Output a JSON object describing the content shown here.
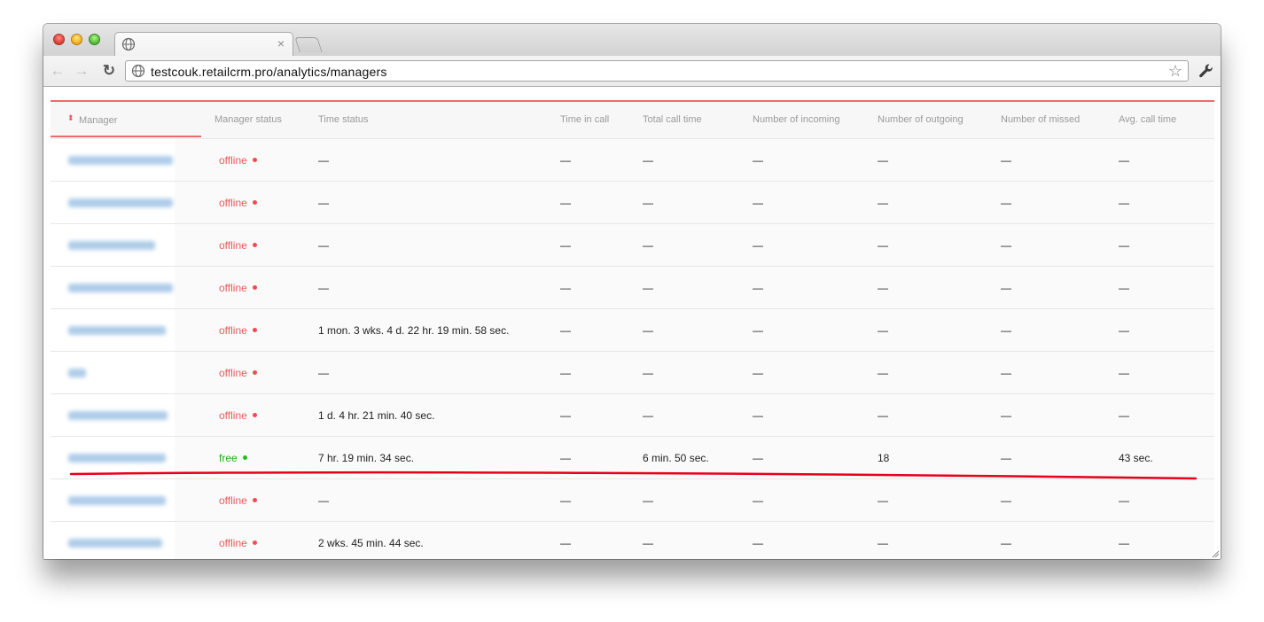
{
  "browser": {
    "url": "testcouk.retailcrm.pro/analytics/managers",
    "tab_close": "×",
    "nav_back": "←",
    "nav_forward": "→",
    "nav_reload": "↻",
    "star": "☆"
  },
  "table": {
    "headers": {
      "manager": "Manager",
      "manager_status": "Manager status",
      "time_status": "Time status",
      "time_in_call": "Time in call",
      "total_call_time": "Total call time",
      "incoming": "Number of incoming",
      "outgoing": "Number of outgoing",
      "missed": "Number of missed",
      "avg_call_time": "Avg. call time"
    },
    "sort_icon": "⬍",
    "rows": [
      {
        "status": "offline",
        "time_status": "—",
        "time_in_call": "—",
        "total": "—",
        "incoming": "—",
        "outgoing": "—",
        "missed": "—",
        "avg": "—"
      },
      {
        "status": "offline",
        "time_status": "—",
        "time_in_call": "—",
        "total": "—",
        "incoming": "—",
        "outgoing": "—",
        "missed": "—",
        "avg": "—"
      },
      {
        "status": "offline",
        "time_status": "—",
        "time_in_call": "—",
        "total": "—",
        "incoming": "—",
        "outgoing": "—",
        "missed": "—",
        "avg": "—"
      },
      {
        "status": "offline",
        "time_status": "—",
        "time_in_call": "—",
        "total": "—",
        "incoming": "—",
        "outgoing": "—",
        "missed": "—",
        "avg": "—"
      },
      {
        "status": "offline",
        "time_status": "1 mon. 3 wks. 4 d. 22 hr. 19 min. 58 sec.",
        "time_in_call": "—",
        "total": "—",
        "incoming": "—",
        "outgoing": "—",
        "missed": "—",
        "avg": "—"
      },
      {
        "status": "offline",
        "time_status": "—",
        "time_in_call": "—",
        "total": "—",
        "incoming": "—",
        "outgoing": "—",
        "missed": "—",
        "avg": "—"
      },
      {
        "status": "offline",
        "time_status": "1 d. 4 hr. 21 min. 40 sec.",
        "time_in_call": "—",
        "total": "—",
        "incoming": "—",
        "outgoing": "—",
        "missed": "—",
        "avg": "—"
      },
      {
        "status": "free",
        "time_status": "7 hr. 19 min. 34 sec.",
        "time_in_call": "—",
        "total": "6 min. 50 sec.",
        "incoming": "—",
        "outgoing": "18",
        "missed": "—",
        "avg": "43 sec."
      },
      {
        "status": "offline",
        "time_status": "—",
        "time_in_call": "—",
        "total": "—",
        "incoming": "—",
        "outgoing": "—",
        "missed": "—",
        "avg": "—"
      },
      {
        "status": "offline",
        "time_status": "2 wks. 45 min. 44 sec.",
        "time_in_call": "—",
        "total": "—",
        "incoming": "—",
        "outgoing": "—",
        "missed": "—",
        "avg": "—"
      }
    ]
  },
  "colors": {
    "offline": "#ea5a5a",
    "free": "#1fab1f",
    "accent": "#ee6a6a",
    "annotation": "#e8001a"
  }
}
